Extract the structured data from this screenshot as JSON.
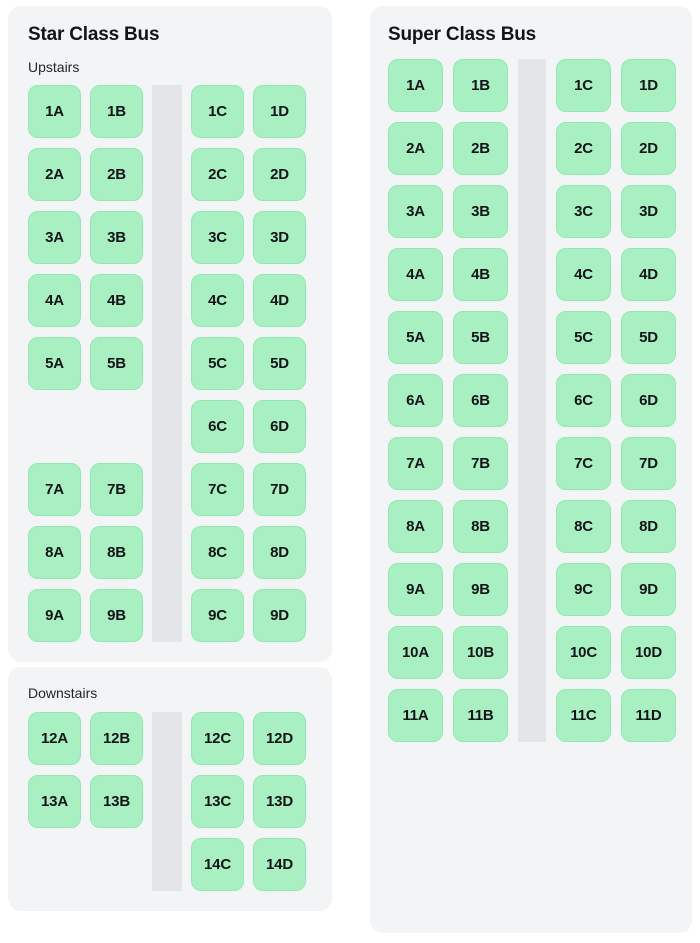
{
  "buses": [
    {
      "id": "star-class-bus",
      "title": "Star Class Bus",
      "decks": [
        {
          "id": "upstairs",
          "label": "Upstairs",
          "rows": [
            {
              "row": "1",
              "seats": [
                "1A",
                "1B",
                "1C",
                "1D"
              ]
            },
            {
              "row": "2",
              "seats": [
                "2A",
                "2B",
                "2C",
                "2D"
              ]
            },
            {
              "row": "3",
              "seats": [
                "3A",
                "3B",
                "3C",
                "3D"
              ]
            },
            {
              "row": "4",
              "seats": [
                "4A",
                "4B",
                "4C",
                "4D"
              ]
            },
            {
              "row": "5",
              "seats": [
                "5A",
                "5B",
                "5C",
                "5D"
              ]
            },
            {
              "row": "6",
              "seats": [
                "",
                "",
                "6C",
                "6D"
              ]
            },
            {
              "row": "7",
              "seats": [
                "7A",
                "7B",
                "7C",
                "7D"
              ]
            },
            {
              "row": "8",
              "seats": [
                "8A",
                "8B",
                "8C",
                "8D"
              ]
            },
            {
              "row": "9",
              "seats": [
                "9A",
                "9B",
                "9C",
                "9D"
              ]
            }
          ]
        },
        {
          "id": "downstairs",
          "label": "Downstairs",
          "rows": [
            {
              "row": "12",
              "seats": [
                "12A",
                "12B",
                "12C",
                "12D"
              ]
            },
            {
              "row": "13",
              "seats": [
                "13A",
                "13B",
                "13C",
                "13D"
              ]
            },
            {
              "row": "14",
              "seats": [
                "",
                "",
                "14C",
                "14D"
              ]
            }
          ]
        }
      ]
    },
    {
      "id": "super-class-bus",
      "title": "Super Class Bus",
      "decks": [
        {
          "id": "main",
          "label": "",
          "rows": [
            {
              "row": "1",
              "seats": [
                "1A",
                "1B",
                "1C",
                "1D"
              ]
            },
            {
              "row": "2",
              "seats": [
                "2A",
                "2B",
                "2C",
                "2D"
              ]
            },
            {
              "row": "3",
              "seats": [
                "3A",
                "3B",
                "3C",
                "3D"
              ]
            },
            {
              "row": "4",
              "seats": [
                "4A",
                "4B",
                "4C",
                "4D"
              ]
            },
            {
              "row": "5",
              "seats": [
                "5A",
                "5B",
                "5C",
                "5D"
              ]
            },
            {
              "row": "6",
              "seats": [
                "6A",
                "6B",
                "6C",
                "6D"
              ]
            },
            {
              "row": "7",
              "seats": [
                "7A",
                "7B",
                "7C",
                "7D"
              ]
            },
            {
              "row": "8",
              "seats": [
                "8A",
                "8B",
                "8C",
                "8D"
              ]
            },
            {
              "row": "9",
              "seats": [
                "9A",
                "9B",
                "9C",
                "9D"
              ]
            },
            {
              "row": "10",
              "seats": [
                "10A",
                "10B",
                "10C",
                "10D"
              ]
            },
            {
              "row": "11",
              "seats": [
                "11A",
                "11B",
                "11C",
                "11D"
              ]
            }
          ]
        }
      ]
    }
  ],
  "colors": {
    "page_background": "#ffffff",
    "panel_background": "#f3f4f6",
    "seat_available": "#a8f0c2",
    "seat_border": "#93e8b2",
    "aisle": "#e3e5e9",
    "text": "#111418"
  }
}
